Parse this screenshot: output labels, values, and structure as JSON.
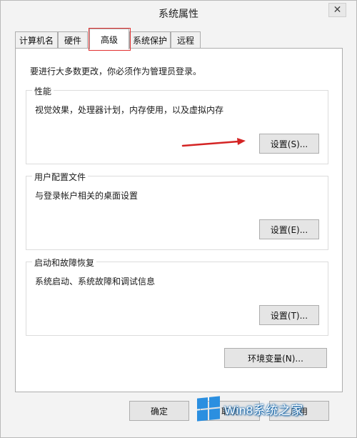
{
  "window": {
    "title": "系统属性",
    "close_symbol": "✕"
  },
  "tabs": [
    {
      "label": "计算机名",
      "active": false
    },
    {
      "label": "硬件",
      "active": false
    },
    {
      "label": "高级",
      "active": true
    },
    {
      "label": "系统保护",
      "active": false
    },
    {
      "label": "远程",
      "active": false
    }
  ],
  "admin_note": "要进行大多数更改，你必须作为管理员登录。",
  "performance": {
    "label": "性能",
    "description": "视觉效果，处理器计划，内存使用，以及虚拟内存",
    "button": "设置(S)..."
  },
  "user_profiles": {
    "label": "用户配置文件",
    "description": "与登录帐户相关的桌面设置",
    "button": "设置(E)..."
  },
  "startup_recovery": {
    "label": "启动和故障恢复",
    "description": "系统启动、系统故障和调试信息",
    "button": "设置(T)..."
  },
  "env_button": "环境变量(N)...",
  "footer": {
    "ok": "确定",
    "cancel": "取消",
    "apply": "应用"
  },
  "watermark": {
    "text": "Win8系统之家"
  },
  "colors": {
    "highlight": "#e23131",
    "arrow": "#d42424",
    "watermark_logo": "#2b8fe0"
  },
  "icons": {
    "close": "close-icon",
    "arrow": "red-arrow-icon",
    "watermark": "windows-logo-icon"
  }
}
